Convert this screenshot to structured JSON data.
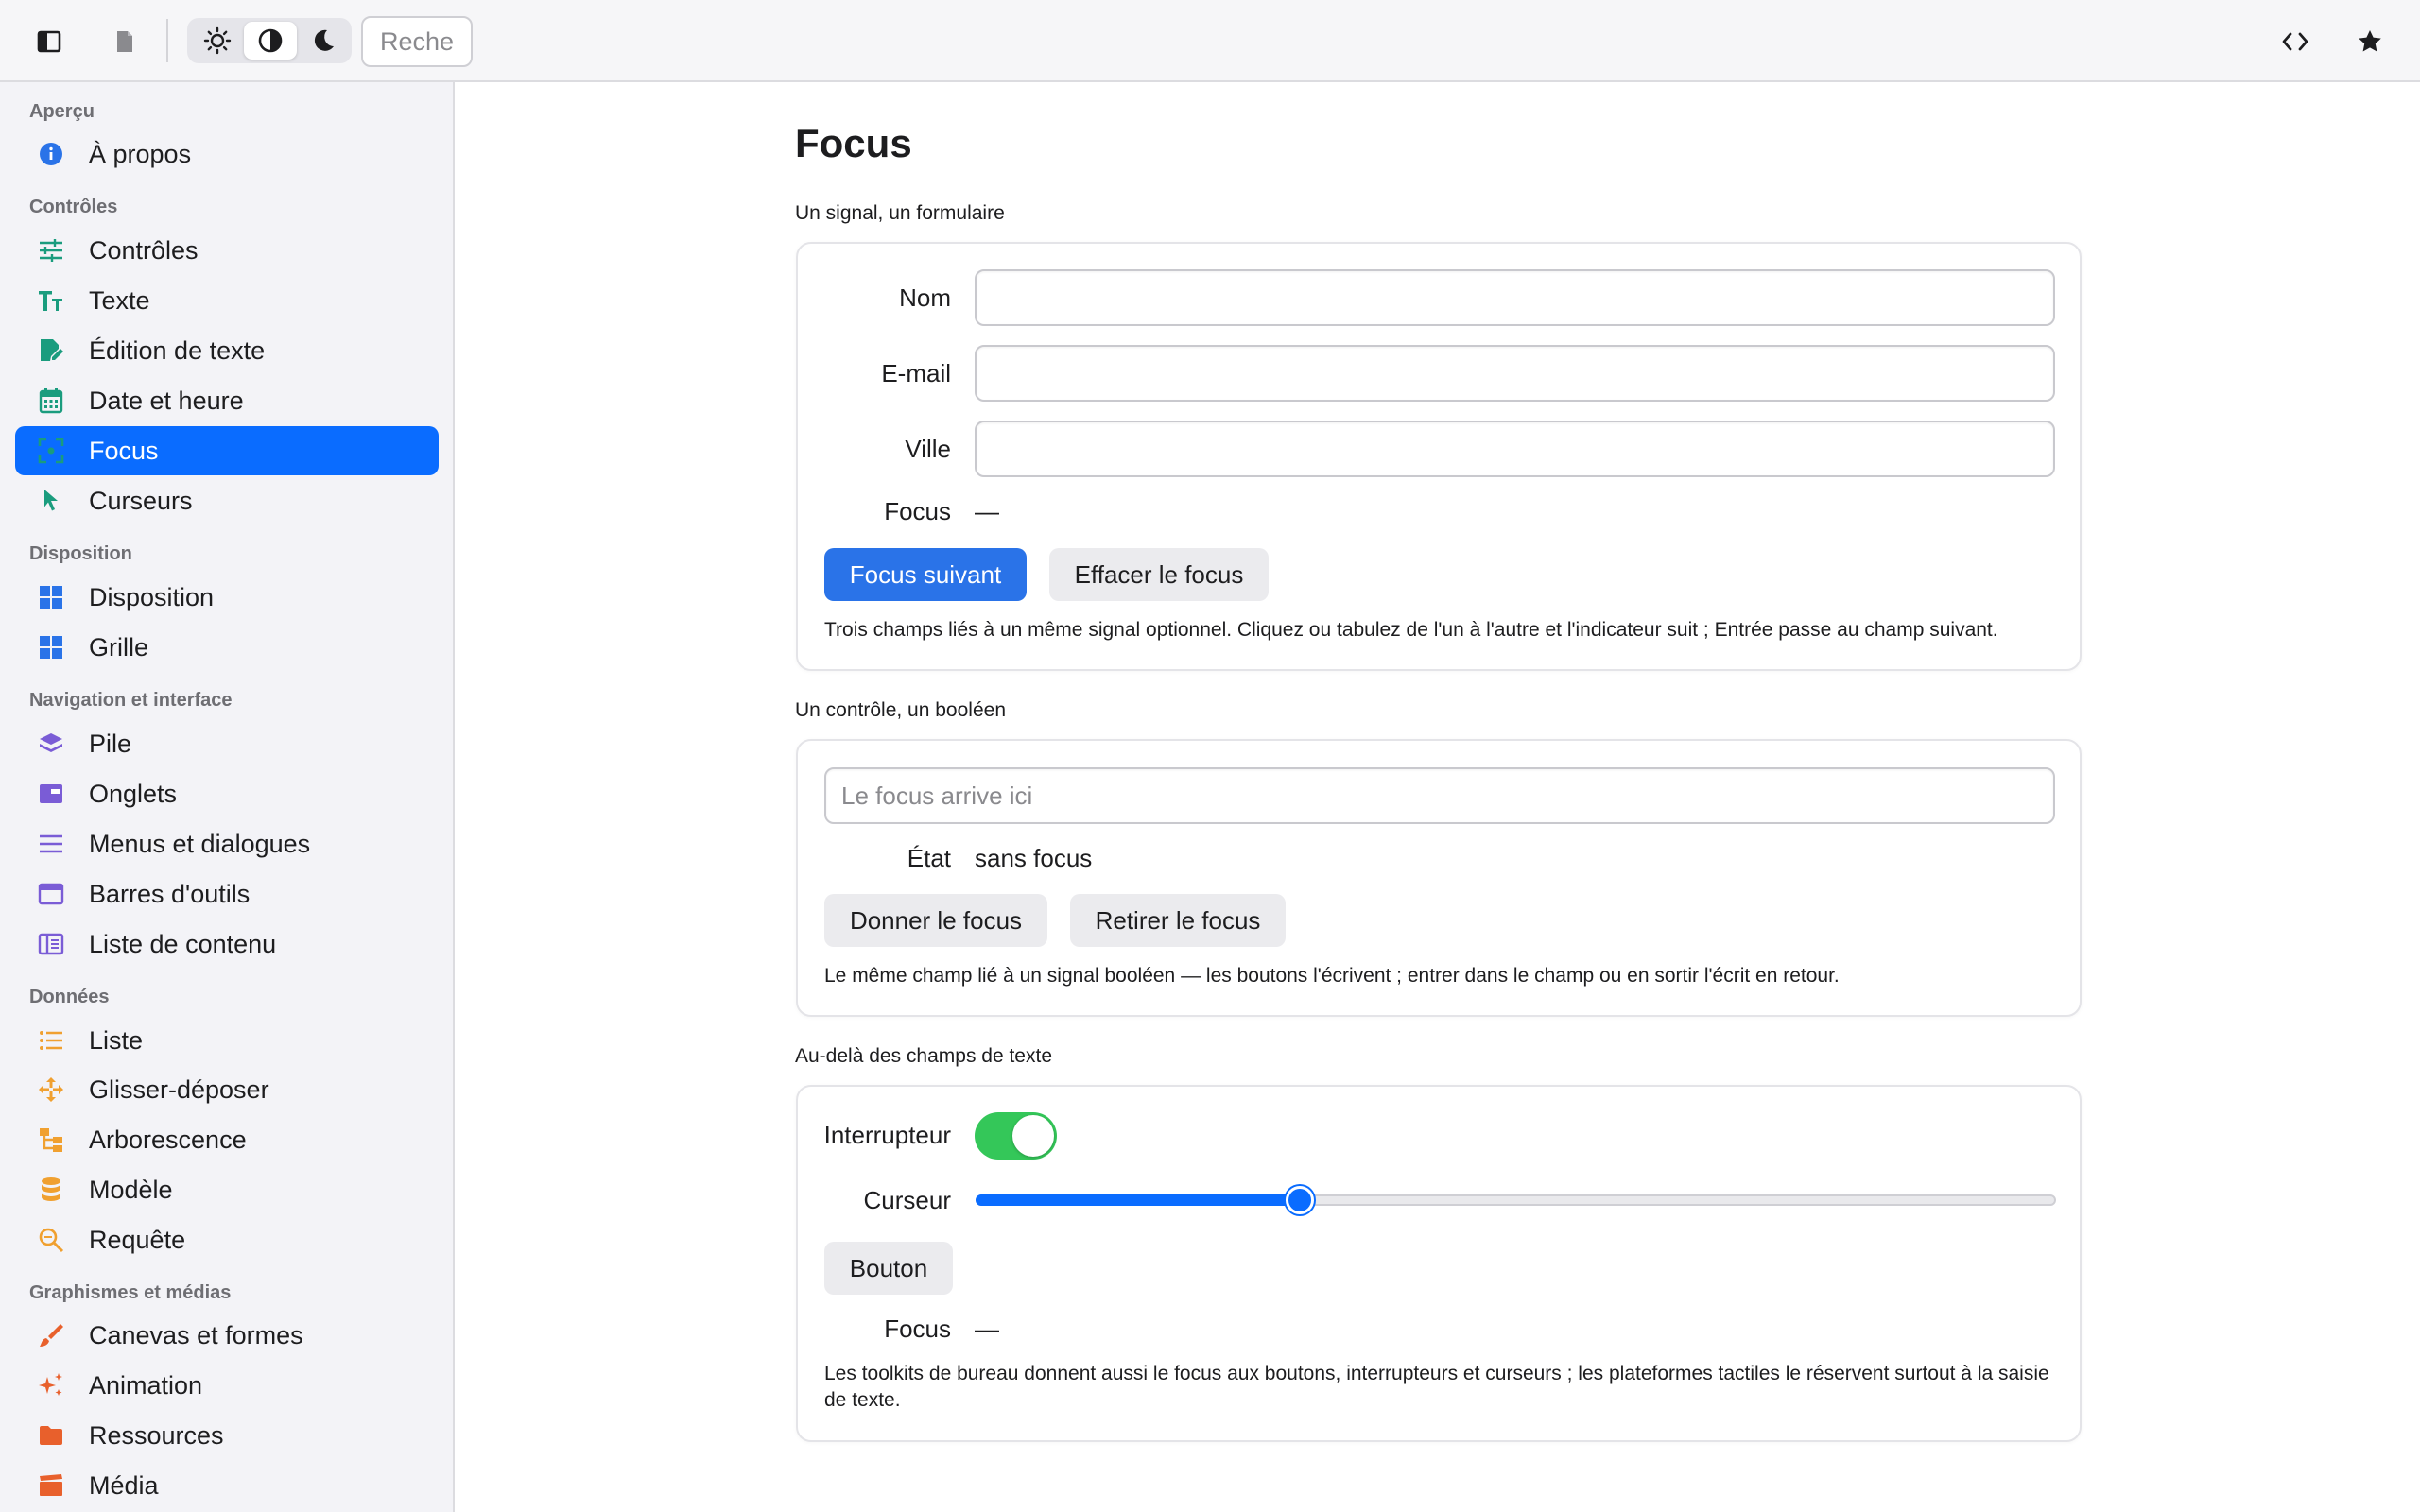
{
  "toolbar": {
    "sidebar_toggle_icon": "sidebar-icon",
    "document_icon": "document-icon",
    "theme": {
      "options": [
        "light",
        "auto",
        "dark"
      ],
      "selected": "auto"
    },
    "search_placeholder": "Rechercher",
    "code_icon": "code-icon",
    "favorite_icon": "star-icon"
  },
  "sidebar": {
    "sections": [
      {
        "title": "Aperçu",
        "items": [
          {
            "label": "À propos",
            "icon": "info-icon",
            "color": "#2a73e8"
          }
        ]
      },
      {
        "title": "Contrôles",
        "items": [
          {
            "label": "Contrôles",
            "icon": "sliders-icon",
            "color": "#1a9c7e"
          },
          {
            "label": "Texte",
            "icon": "text-size-icon",
            "color": "#1a9c7e"
          },
          {
            "label": "Édition de texte",
            "icon": "edit-document-icon",
            "color": "#1a9c7e"
          },
          {
            "label": "Date et heure",
            "icon": "calendar-icon",
            "color": "#1a9c7e"
          },
          {
            "label": "Focus",
            "icon": "focus-icon",
            "color": "#1a9c7e",
            "active": true
          },
          {
            "label": "Curseurs",
            "icon": "cursor-icon",
            "color": "#1a9c7e"
          }
        ]
      },
      {
        "title": "Disposition",
        "items": [
          {
            "label": "Disposition",
            "icon": "layout-icon",
            "color": "#2a73e8"
          },
          {
            "label": "Grille",
            "icon": "grid-icon",
            "color": "#2a73e8"
          }
        ]
      },
      {
        "title": "Navigation et interface",
        "items": [
          {
            "label": "Pile",
            "icon": "stack-icon",
            "color": "#7a5cd6"
          },
          {
            "label": "Onglets",
            "icon": "tabs-icon",
            "color": "#7a5cd6"
          },
          {
            "label": "Menus et dialogues",
            "icon": "menu-icon",
            "color": "#7a5cd6"
          },
          {
            "label": "Barres d'outils",
            "icon": "toolbar-icon",
            "color": "#7a5cd6"
          },
          {
            "label": "Liste de contenu",
            "icon": "content-list-icon",
            "color": "#7a5cd6"
          }
        ]
      },
      {
        "title": "Données",
        "items": [
          {
            "label": "Liste",
            "icon": "list-icon",
            "color": "#f0a030"
          },
          {
            "label": "Glisser-déposer",
            "icon": "move-icon",
            "color": "#f0a030"
          },
          {
            "label": "Arborescence",
            "icon": "tree-icon",
            "color": "#f0a030"
          },
          {
            "label": "Modèle",
            "icon": "database-icon",
            "color": "#f0a030"
          },
          {
            "label": "Requête",
            "icon": "search-icon",
            "color": "#f0a030"
          }
        ]
      },
      {
        "title": "Graphismes et médias",
        "items": [
          {
            "label": "Canevas et formes",
            "icon": "brush-icon",
            "color": "#e8602c"
          },
          {
            "label": "Animation",
            "icon": "sparkles-icon",
            "color": "#e8602c"
          },
          {
            "label": "Ressources",
            "icon": "folder-icon",
            "color": "#e8602c"
          },
          {
            "label": "Média",
            "icon": "clapperboard-icon",
            "color": "#e8602c"
          }
        ]
      }
    ]
  },
  "main": {
    "title": "Focus",
    "section1": {
      "caption": "Un signal, un formulaire",
      "fields": [
        {
          "label": "Nom",
          "value": ""
        },
        {
          "label": "E-mail",
          "value": ""
        },
        {
          "label": "Ville",
          "value": ""
        }
      ],
      "focus_label": "Focus",
      "focus_value": "—",
      "next_button": "Focus suivant",
      "clear_button": "Effacer le focus",
      "note": "Trois champs liés à un même signal optionnel. Cliquez ou tabulez de l'un à l'autre et l'indicateur suit ; Entrée passe au champ suivant."
    },
    "section2": {
      "caption": "Un contrôle, un booléen",
      "field_placeholder": "Le focus arrive ici",
      "state_label": "État",
      "state_value": "sans focus",
      "give_button": "Donner le focus",
      "remove_button": "Retirer le focus",
      "note": "Le même champ lié à un signal booléen — les boutons l'écrivent ; entrer dans le champ ou en sortir l'écrit en retour."
    },
    "section3": {
      "caption": "Au-delà des champs de texte",
      "switch_label": "Interrupteur",
      "switch_on": true,
      "slider_label": "Curseur",
      "slider_value": 0.3,
      "button_label": "Bouton",
      "focus_label": "Focus",
      "focus_value": "—",
      "note": "Les toolkits de bureau donnent aussi le focus aux boutons, interrupteurs et curseurs ; les plateformes tactiles le réservent surtout à la saisie de texte."
    }
  },
  "colors": {
    "accent": "#0a6cff",
    "primary_button": "#2a73e8",
    "switch_on": "#34c759"
  }
}
